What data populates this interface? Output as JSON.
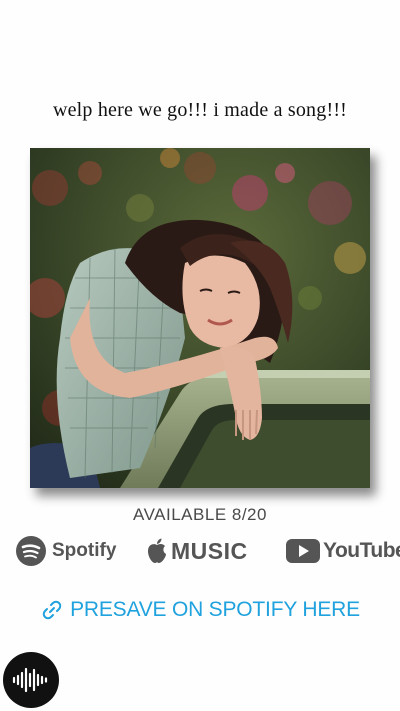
{
  "post": {
    "headline": "welp here we go!!! i made a song!!!"
  },
  "release": {
    "available": "AVAILABLE 8/20"
  },
  "platforms": {
    "spotify": "Spotify",
    "apple": "MUSIC",
    "youtube": "YouTube"
  },
  "presave": {
    "label": "PRESAVE ON SPOTIFY HERE",
    "color": "#1fa2dd"
  },
  "icons": {
    "spotify": "spotify-logo-icon",
    "apple": "apple-logo-icon",
    "youtube": "youtube-play-icon",
    "link": "link-icon",
    "sound": "soundwave-icon"
  }
}
